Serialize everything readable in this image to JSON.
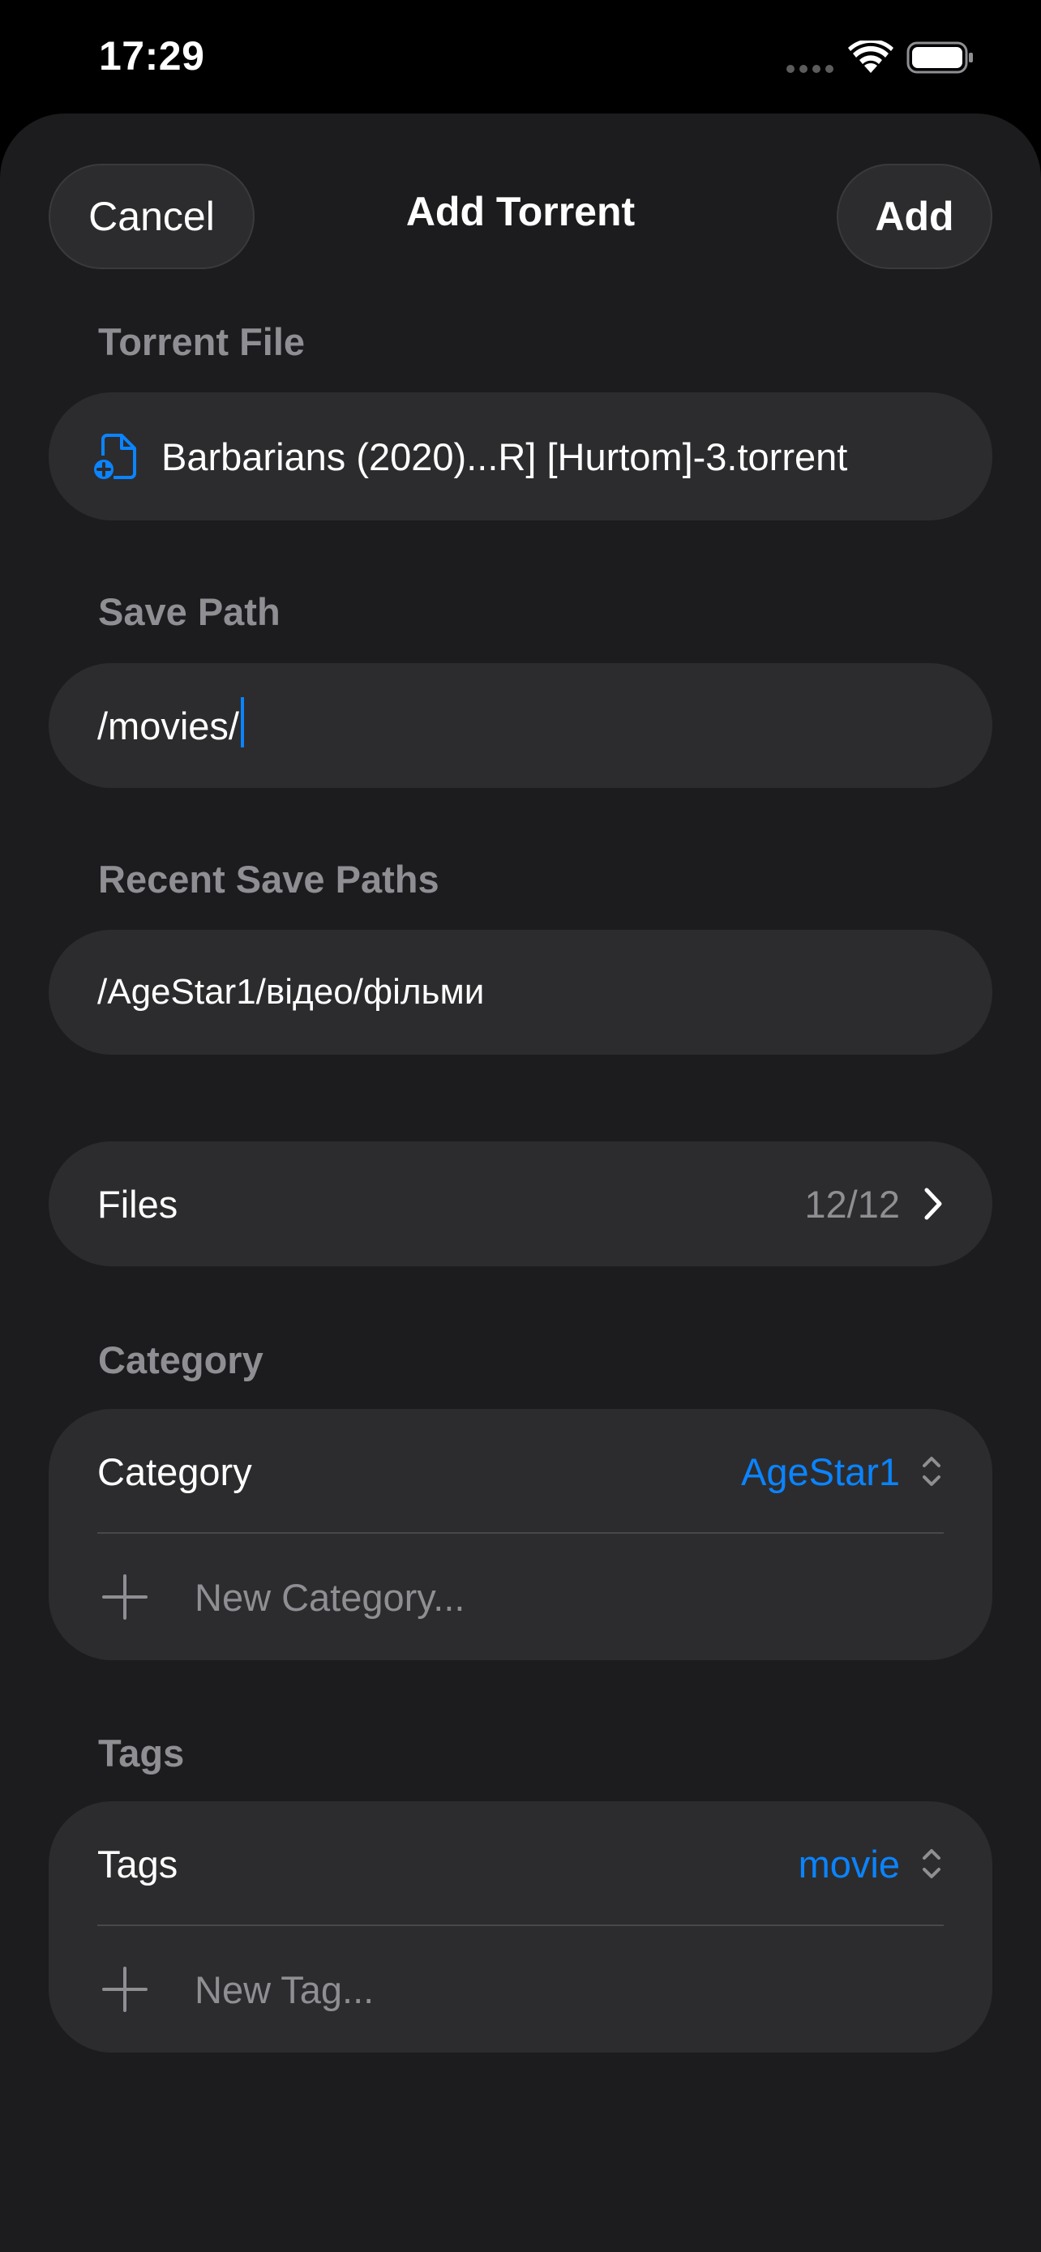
{
  "status_bar": {
    "time": "17:29"
  },
  "header": {
    "cancel_label": "Cancel",
    "title": "Add Torrent",
    "add_label": "Add"
  },
  "torrent_file": {
    "section_label": "Torrent File",
    "file_name": "Barbarians (2020)...R] [Hurtom]-3.torrent",
    "icon": "doc-badge-plus-icon"
  },
  "save_path": {
    "section_label": "Save Path",
    "value": "/movies/"
  },
  "recent_save_paths": {
    "section_label": "Recent Save Paths",
    "items": [
      "/AgeStar1/відео/фільми"
    ]
  },
  "files": {
    "label": "Files",
    "count": "12/12",
    "icon": "chevron-right-icon"
  },
  "category": {
    "section_label": "Category",
    "row_label": "Category",
    "selected_value": "AgeStar1",
    "new_placeholder": "New Category..."
  },
  "tags": {
    "section_label": "Tags",
    "row_label": "Tags",
    "selected_value": "movie",
    "new_placeholder": "New Tag..."
  },
  "colors": {
    "accent": "#0a84ff",
    "background": "#1c1c1e",
    "card": "#2c2c2e",
    "secondary_text": "#8e8e93"
  }
}
